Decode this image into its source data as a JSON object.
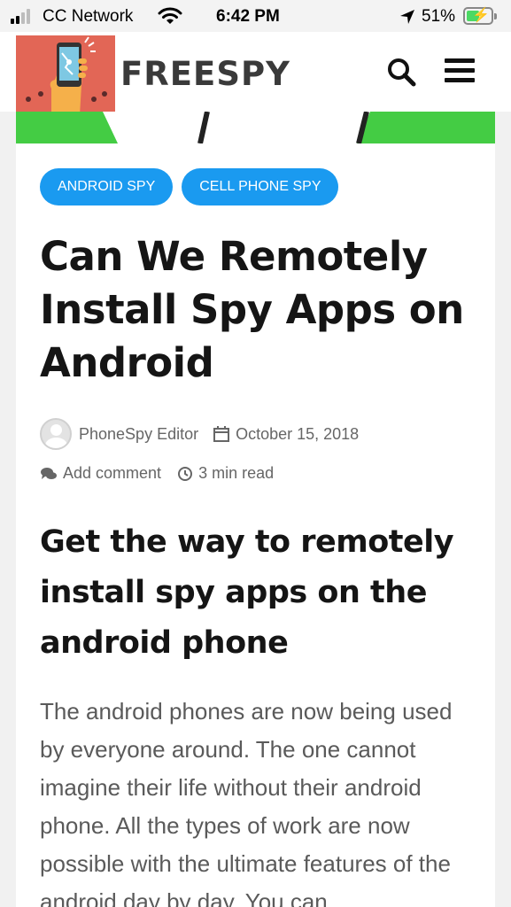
{
  "status": {
    "carrier": "CC Network",
    "time": "6:42 PM",
    "battery_pct": "51%"
  },
  "header": {
    "brand": "FREESPY",
    "logo_icon": "phone-in-hand-logo",
    "search_icon": "search-icon",
    "menu_icon": "hamburger-menu-icon"
  },
  "article": {
    "tags": [
      "ANDROID SPY",
      "CELL PHONE SPY"
    ],
    "title": "Can We Remotely Install Spy Apps on Android",
    "author": "PhoneSpy Editor",
    "date": "October 15, 2018",
    "comments": "Add comment",
    "read_time": "3 min read",
    "subtitle": "Get the way to remotely install spy apps on the android phone",
    "body": "The android phones are now being used by everyone around. The one cannot imagine their life without their android phone. All the types of work are now possible with the ultimate features of the android day by day. You can"
  },
  "colors": {
    "tag_bg": "#1a9af0",
    "logo_bg": "#e26656",
    "hero_green": "#44cc44"
  }
}
